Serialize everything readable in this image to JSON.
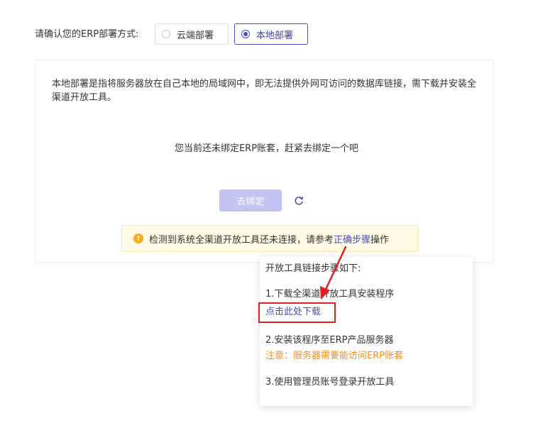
{
  "deploy": {
    "label": "请确认您的ERP部署方式:",
    "options": [
      {
        "label": "云端部署",
        "selected": false
      },
      {
        "label": "本地部署",
        "selected": true
      }
    ]
  },
  "panel": {
    "description": "本地部署是指将服务器放在自己本地的局域网中，即无法提供外网可访问的数据库链接，需下载并安装全渠道开放工具。",
    "empty_message": "您当前还未绑定ERP账套，赶紧去绑定一个吧",
    "bind_button": "去绑定",
    "refresh_icon": "refresh-icon"
  },
  "warning": {
    "icon": "exclamation-circle-icon",
    "text_before": "检测到系统全渠道开放工具还未连接，请参考",
    "link": "正确步骤",
    "text_after": "操作"
  },
  "popover": {
    "title": "开放工具链接步骤如下:",
    "step1": "1.下载全渠道开放工具安装程序",
    "step1_link": "点击此处下载",
    "step2": "2.安装该程序至ERP产品服务器",
    "step2_note": "注意：服务器需要能访问ERP账套",
    "step3": "3.使用管理员账号登录开放工具"
  },
  "colors": {
    "accent": "#4a4cc4",
    "warning_bg": "#fffbe6",
    "warning_icon": "#faad14",
    "note": "#fa8c16",
    "annotation_red": "#e02020"
  }
}
